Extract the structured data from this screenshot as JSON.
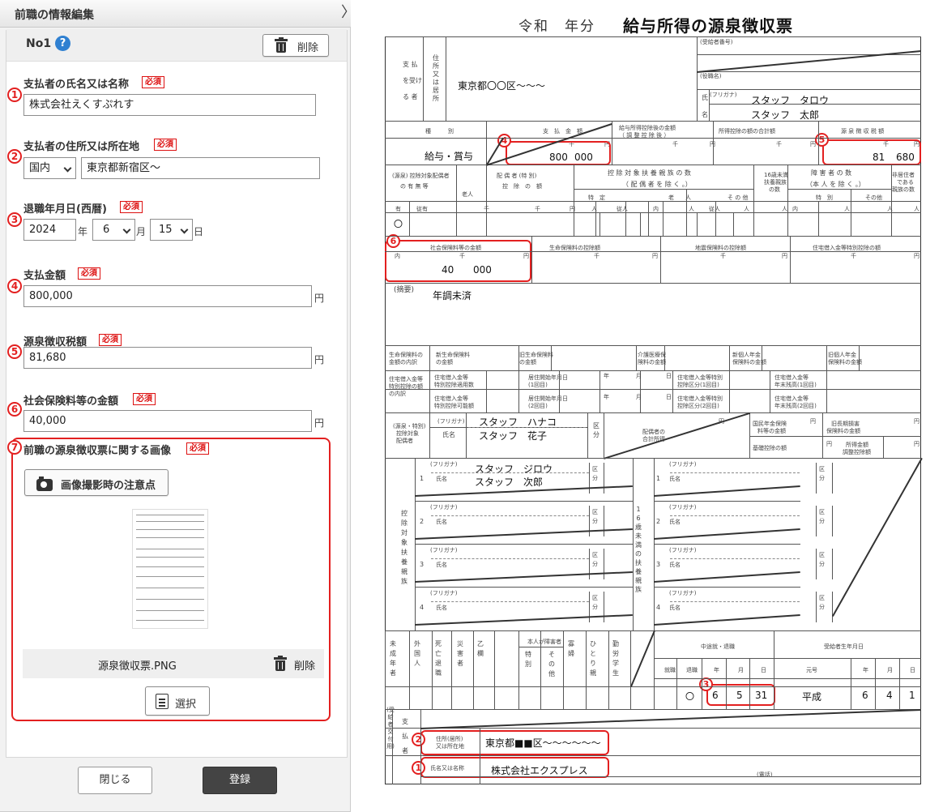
{
  "panel": {
    "title": "前職の情報編集",
    "close_glyph": "〉",
    "record_label": "No1",
    "help_glyph": "?",
    "delete_label": "削除",
    "required": "必須",
    "fields": {
      "payer_name": {
        "num": "1",
        "label": "支払者の氏名又は名称",
        "value": "株式会社えくすぷれす"
      },
      "payer_address": {
        "num": "2",
        "label": "支払者の住所又は所在地",
        "country": "国内",
        "value": "東京都新宿区～"
      },
      "retire_date": {
        "num": "3",
        "label": "退職年月日(西暦)",
        "year": "2024",
        "year_unit": "年",
        "month": "6",
        "month_unit": "月",
        "day": "15",
        "day_unit": "日"
      },
      "payment": {
        "num": "4",
        "label": "支払金額",
        "value": "800,000",
        "unit": "円"
      },
      "withholding": {
        "num": "5",
        "label": "源泉徴収税額",
        "value": "81,680",
        "unit": "円"
      },
      "insurance": {
        "num": "6",
        "label": "社会保険料等の金額",
        "value": "40,000",
        "unit": "円"
      }
    },
    "image_section": {
      "num": "7",
      "label": "前職の源泉徴収票に関する画像",
      "tips_button": "画像撮影時の注意点",
      "file_name": "源泉徴収票.PNG",
      "file_delete": "削除",
      "select_button": "選択"
    },
    "close_button": "閉じる",
    "register_button": "登録",
    "colors": {
      "accent_red": "#e32020",
      "help_blue": "#2f80d1",
      "register_bg": "#444444"
    }
  },
  "doc": {
    "title_era": "令和",
    "title_year": "年分",
    "title_main": "給与所得の源泉徴収票",
    "labels": {
      "recipient_no": "(受給者番号)",
      "position": "(役職名)",
      "furigana": "(フリガナ)",
      "shi": "氏",
      "mei": "名",
      "payee_side": [
        "支 払",
        "を受け",
        "る 者"
      ],
      "address_v": [
        "住",
        "所",
        "又",
        "は",
        "居",
        "所"
      ],
      "type": "種　　　別",
      "amount": "支　払　金　額",
      "after_deduction": "給与所得控除後の金額",
      "after_deduction_sub": "（ 調 整 控 除 後 ）",
      "deduction_total": "所得控除の額の合計額",
      "tax": "源 泉 徴 収 税 額",
      "spouse_deduction": "(源泉) 控除対象配偶者",
      "spouse_exist": "の 有 無 等",
      "elderly": "老人",
      "spouse_special": "配 偶 者 (特 別)",
      "spouse_special_amt": "控　除　の　額",
      "dependents": "控 除 対 象 扶 養 親 族 の 数",
      "dependents_sub": "（ 配 偶 者 を 除 く 。）",
      "under16": "16歳未満",
      "under16_b": "扶養親族",
      "under16_c": "の数",
      "disabled": "障 害 者 の 数",
      "disabled_sub": "（本 人 を 除 く 。）",
      "nonres": "非居住者",
      "nonres_b": "である",
      "nonres_c": "親族の数",
      "tokutei": "特　定",
      "rojin": "老　　人",
      "sonota": "そ の 他",
      "tokubetsu": "特　別",
      "sonota2": "その他",
      "ari": "有",
      "juari": "従有",
      "sen": "千",
      "en": "円",
      "nin": "人",
      "jyu": "従人",
      "uchi": "内",
      "social": "社会保険料等の金額",
      "life": "生命保険料の控除額",
      "quake": "地震保険料の控除額",
      "housing": "住宅借入金等特別控除の額",
      "remarks": "(摘要)",
      "life_breakdown": [
        "生命保険料の",
        "金額の内訳"
      ],
      "new_life": [
        "新生命保険料",
        "の金額"
      ],
      "old_life": [
        "旧生命保険料",
        "の金額"
      ],
      "care": [
        "介護医療保",
        "険料の金額"
      ],
      "new_pension": [
        "新個人年金",
        "保険料の金額"
      ],
      "old_pension": [
        "旧個人年金",
        "保険料の金額"
      ],
      "housing_breakdown": [
        "住宅借入金等",
        "特別控除の額",
        "の内訳"
      ],
      "housing_ok": [
        "住宅借入金等",
        "特別控除適用数"
      ],
      "residence_start1": [
        "居住開始年月日",
        "(1回目)"
      ],
      "residence_start2": [
        "居住開始年月日",
        "(2回目)"
      ],
      "housing_kubun1": [
        "住宅借入金等特別",
        "控除区分(1回目)"
      ],
      "housing_kubun2": [
        "住宅借入金等特別",
        "控除区分(2回目)"
      ],
      "housing_balance1": [
        "住宅借入金等",
        "年末残高(1回目)"
      ],
      "housing_balance2": [
        "住宅借入金等",
        "年末残高(2回目)"
      ],
      "housing_possible": [
        "住宅借入金等",
        "特別控除可能額"
      ],
      "nen": "年",
      "tsuki": "月",
      "hi": "日",
      "spouse_block": [
        "(源泉・特別)",
        "控除対象",
        "配偶者"
      ],
      "shimei": "氏名",
      "kubun": [
        "区",
        "分"
      ],
      "spouse_income": [
        "配偶者の",
        "合計所得"
      ],
      "national_pension": [
        "国民年金保険",
        "料等の金額"
      ],
      "old_long": [
        "旧長期損害",
        "保険料の金額"
      ],
      "basic": "基礎控除の額",
      "income_adj": [
        "所得金額",
        "調整控除額"
      ],
      "dep_vertical": [
        "控",
        "除",
        "対",
        "象",
        "扶",
        "養",
        "親",
        "族"
      ],
      "under16_vertical": [
        "1",
        "6",
        "歳",
        "未",
        "満",
        "の",
        "扶",
        "養",
        "親",
        "族"
      ],
      "bottom_heads": [
        "未成年者",
        "外国人",
        "死亡退職",
        "災害者",
        "乙欄",
        "特別",
        "その他",
        "寡婦",
        "ひとり親",
        "勤労学生"
      ],
      "disabled_self": "本人が障害者",
      "mid_year": "中途就・退職",
      "shushoku": "就職",
      "taishoku": "退職",
      "birth": "受給者生年月日",
      "gengo": "元号",
      "payer_v": [
        "支",
        "払",
        "者"
      ],
      "recipient_v": "(受給者交付用)",
      "addr_label": [
        "住所(居所)",
        "又は所在地"
      ],
      "name_label": "氏名又は名称",
      "tel": "(電話)"
    },
    "values": {
      "address": "東京都〇〇区～～～",
      "name_kana": "スタッフ　タロウ",
      "name": "スタッフ　太郎",
      "kind": "給与・賞与",
      "pay_thousands": "800",
      "pay_units": "000",
      "tax_thousands": "81",
      "tax_units": "680",
      "spouse_mark": "〇",
      "social_thousands": "40",
      "social_units": "000",
      "remarks": "年調未済",
      "spouse_kana": "スタッフ　ハナコ",
      "spouse_name": "スタッフ　花子",
      "dep1_kana": "スタッフ　ジロウ",
      "dep1_name": "スタッフ　次郎",
      "dep_nums": [
        "1",
        "2",
        "3",
        "4"
      ],
      "retire_mark": "〇",
      "retire_y": "6",
      "retire_m": "5",
      "retire_d": "31",
      "birth_era": "平成",
      "birth_y": "6",
      "birth_m": "4",
      "birth_d": "1",
      "payer_address": "東京都■■区～～～～～～",
      "payer_name": "株式会社エクスプレス"
    },
    "markers": [
      "1",
      "2",
      "3",
      "4",
      "5",
      "6"
    ]
  }
}
